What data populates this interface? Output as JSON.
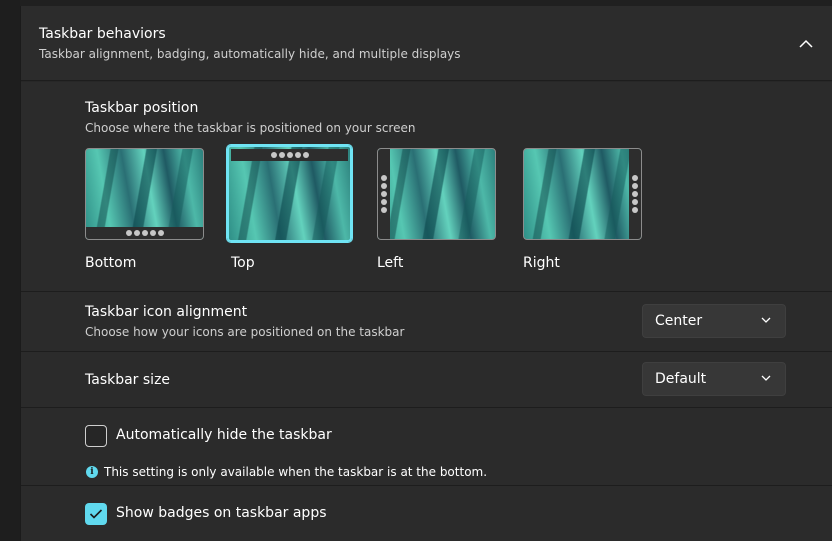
{
  "header": {
    "title": "Taskbar behaviors",
    "subtitle": "Taskbar alignment, badging, automatically hide, and multiple displays",
    "collapse_icon": "chevron-up-icon"
  },
  "position": {
    "title": "Taskbar position",
    "subtitle": "Choose where the taskbar is positioned on your screen",
    "selected": "Top",
    "options": [
      {
        "label": "Bottom"
      },
      {
        "label": "Top"
      },
      {
        "label": "Left"
      },
      {
        "label": "Right"
      }
    ]
  },
  "alignment": {
    "title": "Taskbar icon alignment",
    "subtitle": "Choose how your icons are positioned on the taskbar",
    "value": "Center"
  },
  "size": {
    "title": "Taskbar size",
    "value": "Default"
  },
  "autohide": {
    "label": "Automatically hide the taskbar",
    "checked": false,
    "info": "This setting is only available when the taskbar is at the bottom."
  },
  "badges": {
    "label": "Show badges on taskbar apps",
    "checked": true
  },
  "colors": {
    "accent": "#60d9ee",
    "background": "#202020",
    "card": "#2b2b2b"
  }
}
